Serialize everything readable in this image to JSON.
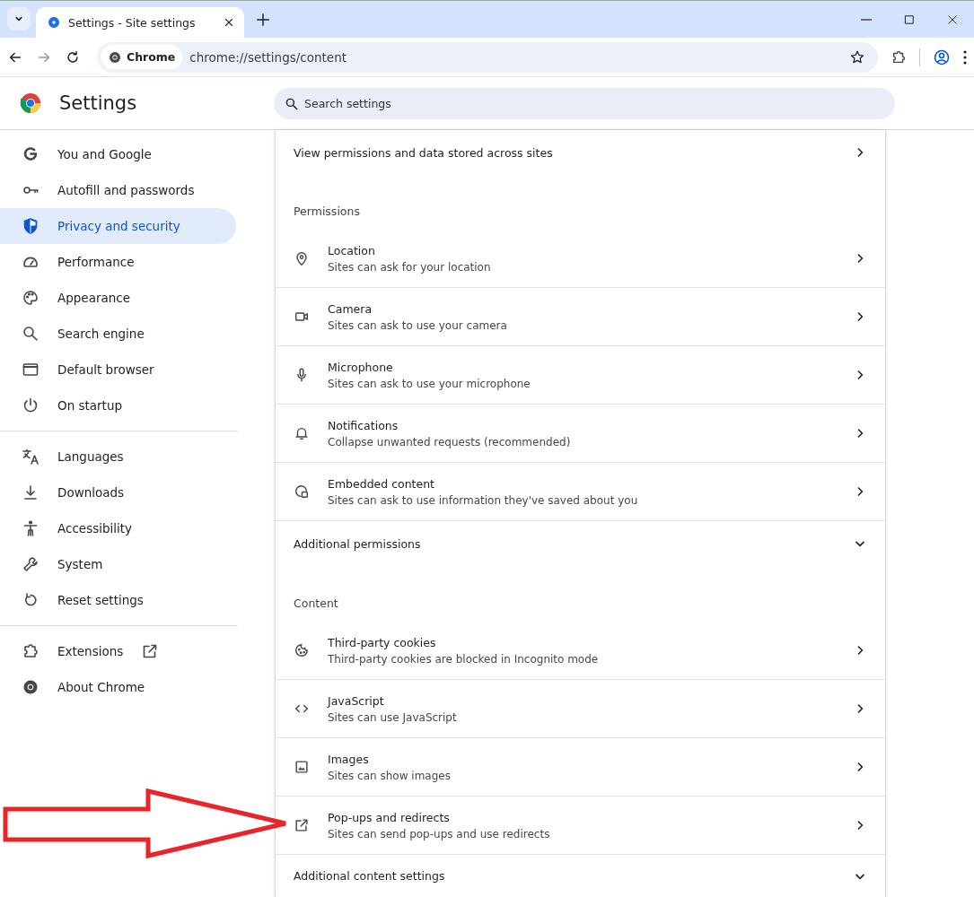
{
  "browser": {
    "tabs": [
      {
        "title": "Settings - Site settings",
        "selected": true
      }
    ],
    "address": {
      "chip": "Chrome",
      "url": "chrome://settings/content"
    }
  },
  "header": {
    "title": "Settings",
    "search": {
      "placeholder": "Search settings"
    }
  },
  "sidebar": {
    "groups": [
      [
        {
          "label": "You and Google",
          "selected": false
        },
        {
          "label": "Autofill and passwords",
          "selected": false
        },
        {
          "label": "Privacy and security",
          "selected": true
        },
        {
          "label": "Performance",
          "selected": false
        },
        {
          "label": "Appearance",
          "selected": false
        },
        {
          "label": "Search engine",
          "selected": false
        },
        {
          "label": "Default browser",
          "selected": false
        },
        {
          "label": "On startup",
          "selected": false
        }
      ],
      [
        {
          "label": "Languages",
          "selected": false
        },
        {
          "label": "Downloads",
          "selected": false
        },
        {
          "label": "Accessibility",
          "selected": false
        },
        {
          "label": "System",
          "selected": false
        },
        {
          "label": "Reset settings",
          "selected": false
        }
      ],
      [
        {
          "label": "Extensions",
          "selected": false,
          "external": true
        },
        {
          "label": "About Chrome",
          "selected": false
        }
      ]
    ]
  },
  "main": {
    "top_link": "View permissions and data stored across sites",
    "sections": [
      {
        "heading": "Permissions",
        "rows": [
          {
            "title": "Location",
            "subtitle": "Sites can ask for your location"
          },
          {
            "title": "Camera",
            "subtitle": "Sites can ask to use your camera"
          },
          {
            "title": "Microphone",
            "subtitle": "Sites can ask to use your microphone"
          },
          {
            "title": "Notifications",
            "subtitle": "Collapse unwanted requests (recommended)"
          },
          {
            "title": "Embedded content",
            "subtitle": "Sites can ask to use information they've saved about you"
          }
        ],
        "more": {
          "label": "Additional permissions",
          "expanded": false
        }
      },
      {
        "heading": "Content",
        "rows": [
          {
            "title": "Third-party cookies",
            "subtitle": "Third-party cookies are blocked in Incognito mode"
          },
          {
            "title": "JavaScript",
            "subtitle": "Sites can use JavaScript"
          },
          {
            "title": "Images",
            "subtitle": "Sites can show images"
          },
          {
            "title": "Pop-ups and redirects",
            "subtitle": "Sites can send pop-ups and use redirects"
          }
        ],
        "more": {
          "label": "Additional content settings",
          "expanded": false
        }
      }
    ]
  }
}
